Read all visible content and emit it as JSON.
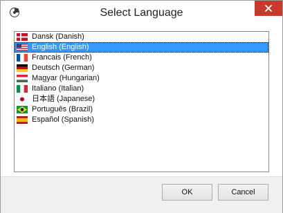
{
  "window": {
    "title": "Select Language",
    "app_icon": "app-logo-icon",
    "close_icon": "close-icon",
    "accent_close": "#c7392b"
  },
  "languages": [
    {
      "label": "Dansk (Danish)",
      "flag": "denmark-flag-icon",
      "selected": false
    },
    {
      "label": "English (English)",
      "flag": "usa-flag-icon",
      "selected": true
    },
    {
      "label": "Francais (French)",
      "flag": "france-flag-icon",
      "selected": false
    },
    {
      "label": "Deutsch (German)",
      "flag": "germany-flag-icon",
      "selected": false
    },
    {
      "label": "Magyar (Hungarian)",
      "flag": "hungary-flag-icon",
      "selected": false
    },
    {
      "label": "Italiano (Italian)",
      "flag": "italy-flag-icon",
      "selected": false
    },
    {
      "label": "日本語 (Japanese)",
      "flag": "japan-flag-icon",
      "selected": false
    },
    {
      "label": "Português (Brazil)",
      "flag": "brazil-flag-icon",
      "selected": false
    },
    {
      "label": "Español (Spanish)",
      "flag": "spain-flag-icon",
      "selected": false
    }
  ],
  "buttons": {
    "ok_label": "OK",
    "cancel_label": "Cancel"
  },
  "colors": {
    "selection": "#3399ff"
  }
}
